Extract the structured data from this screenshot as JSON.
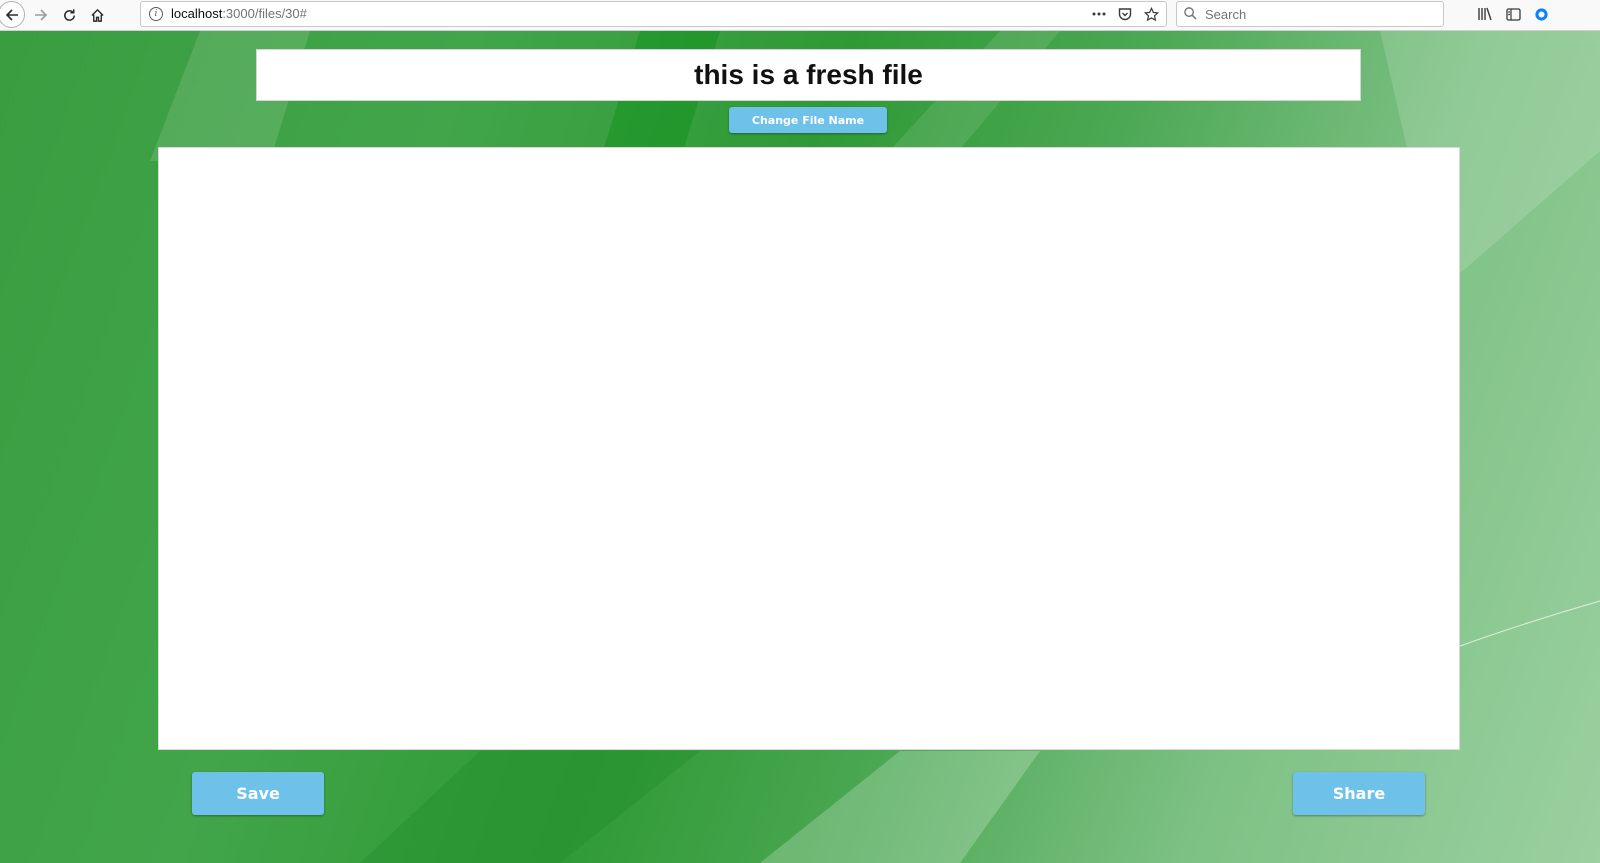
{
  "browser": {
    "url_host": "localhost",
    "url_path": ":3000/files/30#",
    "search_placeholder": "Search"
  },
  "icons": {
    "back": "back-arrow-icon",
    "forward": "forward-arrow-icon",
    "reload": "reload-icon",
    "home": "home-icon",
    "info": "info-icon",
    "page_actions": "more-dots-icon",
    "pocket": "pocket-icon",
    "bookmark": "star-icon",
    "search": "search-icon",
    "library": "library-icon",
    "sidebar": "sidebar-icon",
    "extension": "extension-icon"
  },
  "file": {
    "name": "this is a fresh file",
    "change_name_label": "Change File Name",
    "content": ""
  },
  "actions": {
    "save_label": "Save",
    "share_label": "Share"
  },
  "colors": {
    "button": "#6ec2ea",
    "background": "#3f9f45"
  }
}
